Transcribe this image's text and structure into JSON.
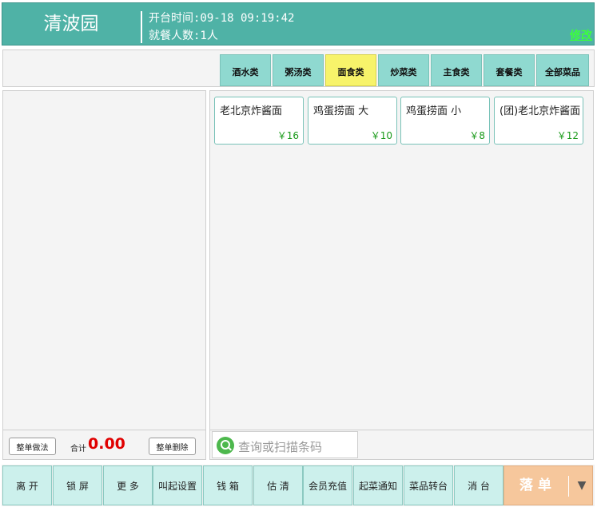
{
  "header": {
    "restaurant_name": "清波园",
    "open_time": "开台时间:09-18 09:19:42",
    "guest_count": "就餐人数:1人",
    "edit_label": "修改"
  },
  "categories": [
    "酒水类",
    "粥汤类",
    "面食类",
    "炒菜类",
    "主食类",
    "套餐类",
    "全部菜品"
  ],
  "active_category": "面食类",
  "dishes": [
    {
      "name": "老北京炸酱面",
      "price": "￥16"
    },
    {
      "name": "鸡蛋捞面 大",
      "price": "￥10"
    },
    {
      "name": "鸡蛋捞面 小",
      "price": "￥8"
    },
    {
      "name": "(团)老北京炸酱面",
      "price": "￥12"
    }
  ],
  "order": {
    "whole_method_label": "整单做法",
    "total_label": "合计",
    "total_value": "0.00",
    "whole_delete_label": "整单删除"
  },
  "search": {
    "placeholder": "查询或扫描条码"
  },
  "toolbar": {
    "buttons": [
      "离 开",
      "锁 屏",
      "更 多",
      "叫起设置",
      "钱 箱",
      "估 清",
      "会员充值",
      "起菜通知",
      "菜品转台",
      "消 台"
    ],
    "submit_label": "落 单",
    "dropdown_icon": "▼"
  },
  "colors": {
    "header": "#4fb2a6",
    "tab": "#8fd9d0",
    "tab_active": "#f7f36a",
    "price": "#1a9a1a",
    "total": "#e00000",
    "submit": "#f6c79c"
  }
}
